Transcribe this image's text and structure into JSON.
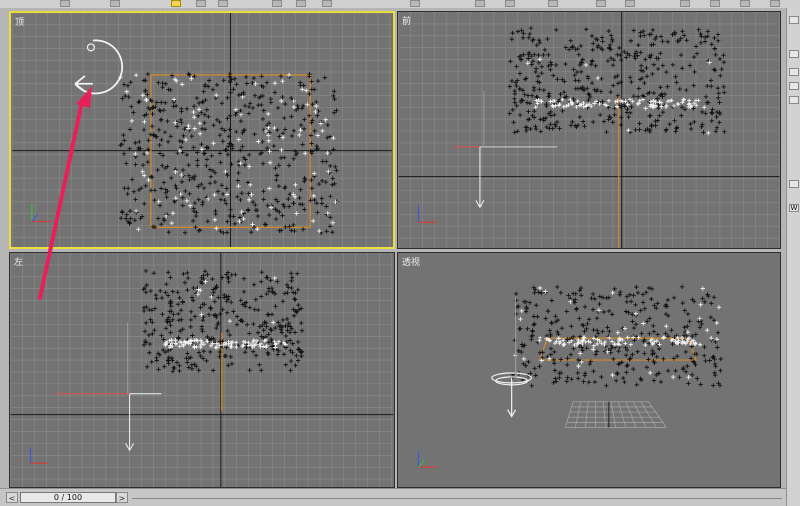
{
  "viewports": {
    "top": {
      "label": "顶"
    },
    "front": {
      "label": "前"
    },
    "left": {
      "label": "左"
    },
    "perspective": {
      "label": "透视"
    }
  },
  "timeline": {
    "frame_display": "0 / 100",
    "prev": "<",
    "next": ">"
  },
  "right_panel": {
    "letter": "W"
  },
  "colors": {
    "viewport_bg": "#747374",
    "grid": "#8c8b8c",
    "active_border": "#e8df3a",
    "emitter": "#d08a2a",
    "annotation_arrow": "#e8205a"
  },
  "icons": [
    "select-arrow-icon",
    "rotate-gizmo-icon",
    "axis-tripod-icon",
    "camera-target-icon"
  ]
}
